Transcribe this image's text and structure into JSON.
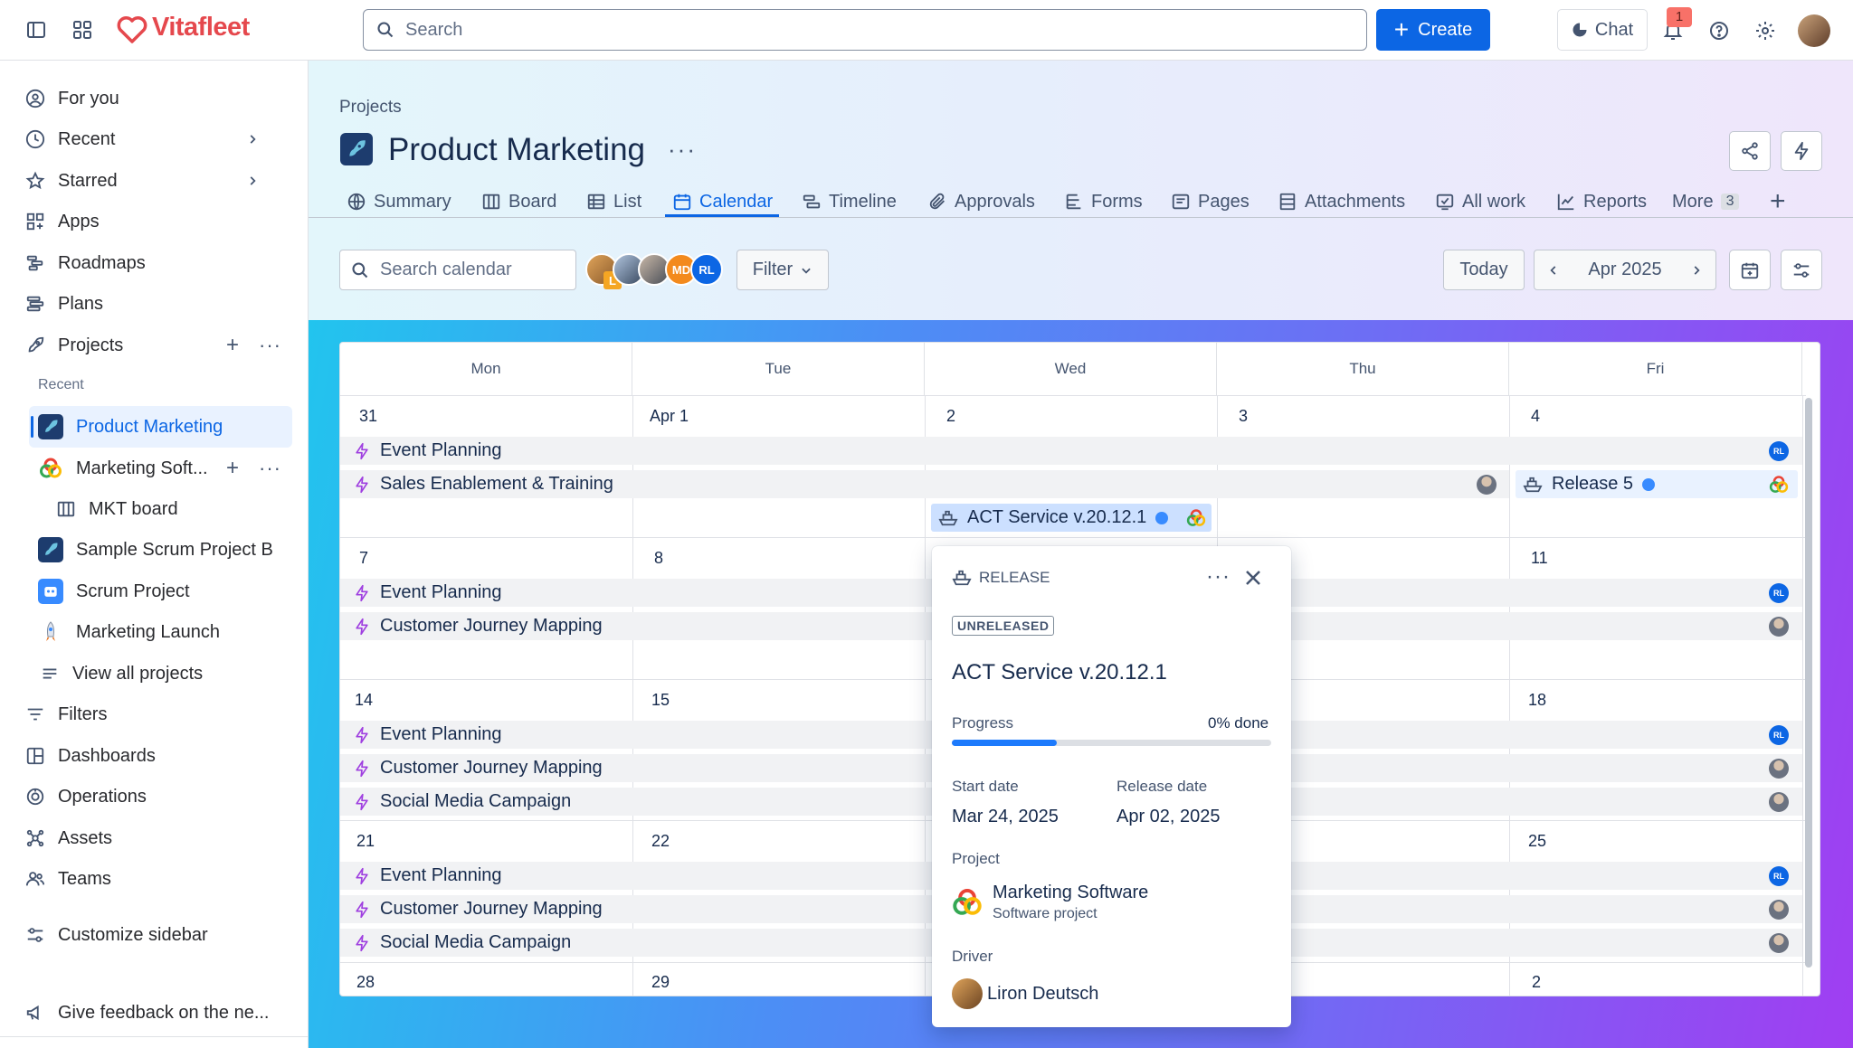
{
  "app": {
    "name": "Vitafleet"
  },
  "topbar": {
    "search_placeholder": "Search",
    "create_label": "Create",
    "chat_label": "Chat",
    "notification_count": "1"
  },
  "sidebar": {
    "items": [
      {
        "label": "For you",
        "icon": "user-circle-icon"
      },
      {
        "label": "Recent",
        "icon": "clock-icon"
      },
      {
        "label": "Starred",
        "icon": "star-icon"
      },
      {
        "label": "Apps",
        "icon": "apps-icon"
      },
      {
        "label": "Roadmaps",
        "icon": "roadmap-icon"
      },
      {
        "label": "Plans",
        "icon": "plans-icon"
      },
      {
        "label": "Projects",
        "icon": "rocket-icon"
      }
    ],
    "recent_heading": "Recent",
    "projects": [
      {
        "label": "Product Marketing",
        "selected": true
      },
      {
        "label": "Marketing Soft..."
      },
      {
        "label": "MKT board"
      },
      {
        "label": "Sample Scrum Project B"
      },
      {
        "label": "Scrum Project"
      },
      {
        "label": "Marketing Launch"
      },
      {
        "label": "View all projects"
      }
    ],
    "bottom_items": [
      {
        "label": "Filters",
        "icon": "filter-icon"
      },
      {
        "label": "Dashboards",
        "icon": "dashboard-icon"
      },
      {
        "label": "Operations",
        "icon": "operations-icon"
      },
      {
        "label": "Assets",
        "icon": "assets-icon"
      },
      {
        "label": "Teams",
        "icon": "teams-icon"
      }
    ],
    "customize_label": "Customize sidebar",
    "feedback_label": "Give feedback on the ne..."
  },
  "header": {
    "breadcrumb": "Projects",
    "title": "Product Marketing",
    "tabs": [
      "Summary",
      "Board",
      "List",
      "Calendar",
      "Timeline",
      "Approvals",
      "Forms",
      "Pages",
      "Attachments",
      "All work",
      "Reports",
      "More"
    ],
    "active_tab": "Calendar",
    "more_count": "3"
  },
  "toolbar": {
    "search_placeholder": "Search calendar",
    "avatars": [
      "L",
      "MD",
      "RL"
    ],
    "filter_label": "Filter",
    "today_label": "Today",
    "month_label": "Apr 2025"
  },
  "calendar": {
    "days": [
      "Mon",
      "Tue",
      "Wed",
      "Thu",
      "Fri"
    ],
    "weeks": [
      {
        "dates": [
          "31",
          "Apr 1",
          "2",
          "3",
          "4"
        ],
        "events": [
          "Event Planning",
          "Sales Enablement & Training"
        ],
        "releases": [
          "ACT Service v.20.12.1",
          "Release 5"
        ]
      },
      {
        "dates": [
          "7",
          "8",
          "",
          "",
          "11"
        ],
        "events": [
          "Event Planning",
          "Customer Journey Mapping"
        ]
      },
      {
        "dates": [
          "14",
          "15",
          "",
          "",
          "18"
        ],
        "events": [
          "Event Planning",
          "Customer Journey Mapping",
          "Social Media Campaign"
        ]
      },
      {
        "dates": [
          "21",
          "22",
          "",
          "",
          "25"
        ],
        "events": [
          "Event Planning",
          "Customer Journey Mapping",
          "Social Media Campaign"
        ]
      },
      {
        "dates": [
          "28",
          "29",
          "",
          "",
          "2"
        ],
        "events": []
      }
    ],
    "assignee_initials": "RL"
  },
  "popup": {
    "type_label": "RELEASE",
    "status": "UNRELEASED",
    "title": "ACT Service v.20.12.1",
    "progress_label": "Progress",
    "progress_text": "0% done",
    "progress_fraction": 0.33,
    "start_label": "Start date",
    "start_value": "Mar 24, 2025",
    "release_label": "Release date",
    "release_value": "Apr 02, 2025",
    "project_label": "Project",
    "project_name": "Marketing Software",
    "project_type": "Software project",
    "driver_label": "Driver",
    "driver_name": "Liron Deutsch"
  },
  "colors": {
    "accent": "#0c66e4",
    "brand": "#e5484d",
    "event_icon": "#9f3fe0"
  }
}
